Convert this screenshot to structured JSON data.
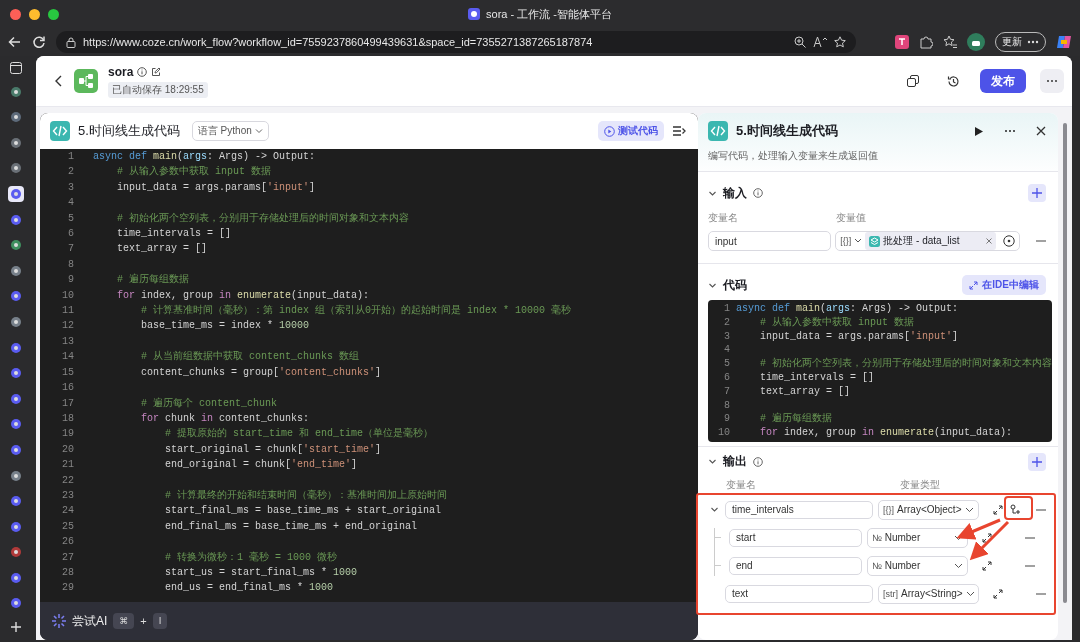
{
  "browser": {
    "title": "sora - 工作流 -智能体平台",
    "url": "https://www.coze.cn/work_flow?workflow_id=7559237860499439631&space_id=7355271387265187874",
    "update_button": "更新"
  },
  "app_header": {
    "name": "sora",
    "autosave": "已自动保存 18:29:55",
    "publish_button": "发布"
  },
  "code_editor": {
    "title": "5.时间线生成代码",
    "language": "语言 Python",
    "test_button": "测试代码",
    "lines": [
      {
        "number": "1",
        "tokens": [
          {
            "text": "async def ",
            "kind": "keyword"
          },
          {
            "text": "main",
            "kind": "function"
          },
          {
            "text": "(",
            "kind": "plain"
          },
          {
            "text": "args",
            "kind": "variable"
          },
          {
            "text": ": Args) -> Output:",
            "kind": "plain"
          }
        ]
      },
      {
        "number": "2",
        "tokens": [
          {
            "text": "    # 从输入参数中获取 input 数据",
            "kind": "comment"
          }
        ]
      },
      {
        "number": "3",
        "tokens": [
          {
            "text": "    input_data = args.params[",
            "kind": "plain"
          },
          {
            "text": "'input'",
            "kind": "string"
          },
          {
            "text": "]",
            "kind": "plain"
          }
        ]
      },
      {
        "number": "4"
      },
      {
        "number": "5",
        "tokens": [
          {
            "text": "    # 初始化两个空列表，分别用于存储处理后的时间对象和文本内容",
            "kind": "comment"
          }
        ]
      },
      {
        "number": "6",
        "tokens": [
          {
            "text": "    time_intervals = []",
            "kind": "plain"
          }
        ]
      },
      {
        "number": "7",
        "tokens": [
          {
            "text": "    text_array = []",
            "kind": "plain"
          }
        ]
      },
      {
        "number": "8"
      },
      {
        "number": "9",
        "tokens": [
          {
            "text": "    # 遍历每组数据",
            "kind": "comment"
          }
        ]
      },
      {
        "number": "10",
        "tokens": [
          {
            "text": "    for",
            "kind": "control"
          },
          {
            "text": " index, group ",
            "kind": "plain"
          },
          {
            "text": "in",
            "kind": "control"
          },
          {
            "text": " enumerate",
            "kind": "function"
          },
          {
            "text": "(input_data):",
            "kind": "plain"
          }
        ]
      },
      {
        "number": "11",
        "tokens": [
          {
            "text": "        # 计算基准时间（毫秒）：第 index 组（索引从0开始）的起始时间是 index * 10000 毫秒",
            "kind": "comment"
          }
        ]
      },
      {
        "number": "12",
        "tokens": [
          {
            "text": "        base_time_ms = index * ",
            "kind": "plain"
          },
          {
            "text": "10000",
            "kind": "number"
          }
        ]
      },
      {
        "number": "13"
      },
      {
        "number": "14",
        "tokens": [
          {
            "text": "        # 从当前组数据中获取 content_chunks 数组",
            "kind": "comment"
          }
        ]
      },
      {
        "number": "15",
        "tokens": [
          {
            "text": "        content_chunks = group[",
            "kind": "plain"
          },
          {
            "text": "'content_chunks'",
            "kind": "string"
          },
          {
            "text": "]",
            "kind": "plain"
          }
        ]
      },
      {
        "number": "16"
      },
      {
        "number": "17",
        "tokens": [
          {
            "text": "        # 遍历每个 content_chunk",
            "kind": "comment"
          }
        ]
      },
      {
        "number": "18",
        "tokens": [
          {
            "text": "        for",
            "kind": "control"
          },
          {
            "text": " chunk ",
            "kind": "plain"
          },
          {
            "text": "in",
            "kind": "control"
          },
          {
            "text": " content_chunks:",
            "kind": "plain"
          }
        ]
      },
      {
        "number": "19",
        "tokens": [
          {
            "text": "            # 提取原始的 start_time 和 end_time（单位是毫秒）",
            "kind": "comment"
          }
        ]
      },
      {
        "number": "20",
        "tokens": [
          {
            "text": "            start_original = chunk[",
            "kind": "plain"
          },
          {
            "text": "'start_time'",
            "kind": "string"
          },
          {
            "text": "]",
            "kind": "plain"
          }
        ]
      },
      {
        "number": "21",
        "tokens": [
          {
            "text": "            end_original = chunk[",
            "kind": "plain"
          },
          {
            "text": "'end_time'",
            "kind": "string"
          },
          {
            "text": "]",
            "kind": "plain"
          }
        ]
      },
      {
        "number": "22"
      },
      {
        "number": "23",
        "tokens": [
          {
            "text": "            # 计算最终的开始和结束时间（毫秒）：基准时间加上原始时间",
            "kind": "comment"
          }
        ]
      },
      {
        "number": "24",
        "tokens": [
          {
            "text": "            start_final_ms = base_time_ms + start_original",
            "kind": "plain"
          }
        ]
      },
      {
        "number": "25",
        "tokens": [
          {
            "text": "            end_final_ms = base_time_ms + end_original",
            "kind": "plain"
          }
        ]
      },
      {
        "number": "26"
      },
      {
        "number": "27",
        "tokens": [
          {
            "text": "            # 转换为微秒：1 毫秒 = 1000 微秒",
            "kind": "comment"
          }
        ]
      },
      {
        "number": "28",
        "tokens": [
          {
            "text": "            start_us = start_final_ms * ",
            "kind": "plain"
          },
          {
            "text": "1000",
            "kind": "number"
          }
        ]
      },
      {
        "number": "29",
        "tokens": [
          {
            "text": "            end_us = end_final_ms * ",
            "kind": "plain"
          },
          {
            "text": "1000",
            "kind": "number"
          }
        ]
      }
    ],
    "ai_bar": {
      "label": "尝试AI",
      "shortcut": [
        {
          "text": "⌘",
          "kind": "key"
        },
        {
          "text": "+",
          "kind": "plus"
        },
        {
          "text": "I",
          "kind": "key"
        }
      ]
    }
  },
  "node_panel": {
    "title": "5.时间线生成代码",
    "description": "编写代码，处理输入变量来生成返回值",
    "input_section": {
      "title": "输入",
      "name_header": "变量名",
      "value_header": "变量值",
      "rows": [
        {
          "name": "input",
          "type_icon": "[{}]",
          "value": "批处理 - data_list"
        }
      ]
    },
    "code_section": {
      "title": "代码",
      "ide_button": "在IDE中编辑",
      "lines": [
        {
          "number": "1",
          "tokens": [
            {
              "text": "async def ",
              "kind": "keyword"
            },
            {
              "text": "main",
              "kind": "function"
            },
            {
              "text": "(",
              "kind": "plain"
            },
            {
              "text": "args",
              "kind": "variable"
            },
            {
              "text": ": Args) -> Output:",
              "kind": "plain"
            }
          ]
        },
        {
          "number": "2",
          "tokens": [
            {
              "text": "    # 从输入参数中获取 input 数据",
              "kind": "comment"
            }
          ]
        },
        {
          "number": "3",
          "tokens": [
            {
              "text": "    input_data = args.params[",
              "kind": "plain"
            },
            {
              "text": "'input'",
              "kind": "string"
            },
            {
              "text": "]",
              "kind": "plain"
            }
          ]
        },
        {
          "number": "4"
        },
        {
          "number": "5",
          "tokens": [
            {
              "text": "    # 初始化两个空列表，分别用于存储处理后的时间对象和文本内容",
              "kind": "comment"
            }
          ]
        },
        {
          "number": "6",
          "tokens": [
            {
              "text": "    time_intervals = []",
              "kind": "plain"
            }
          ]
        },
        {
          "number": "7",
          "tokens": [
            {
              "text": "    text_array = []",
              "kind": "plain"
            }
          ]
        },
        {
          "number": "8"
        },
        {
          "number": "9",
          "tokens": [
            {
              "text": "    # 遍历每组数据",
              "kind": "comment"
            }
          ]
        },
        {
          "number": "10",
          "tokens": [
            {
              "text": "    for",
              "kind": "control"
            },
            {
              "text": " index, group ",
              "kind": "plain"
            },
            {
              "text": "in",
              "kind": "control"
            },
            {
              "text": " enumerate",
              "kind": "function"
            },
            {
              "text": "(input_data):",
              "kind": "plain"
            }
          ]
        }
      ]
    },
    "output_section": {
      "title": "输出",
      "name_header": "变量名",
      "type_header": "变量类型",
      "rows": [
        {
          "name": "time_intervals",
          "type_icon": "[{}]",
          "type": "Array<Object>",
          "expanded": true,
          "children": [
            {
              "name": "start",
              "type_icon": "№",
              "type": "Number"
            },
            {
              "name": "end",
              "type_icon": "№",
              "type": "Number"
            }
          ]
        },
        {
          "name": "text",
          "type_icon": "[str]",
          "type": "Array<String>"
        }
      ]
    }
  }
}
